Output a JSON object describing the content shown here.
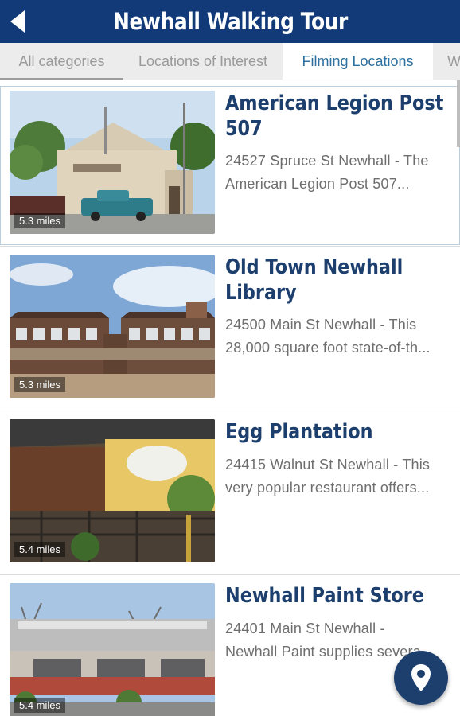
{
  "header": {
    "title": "Newhall Walking Tour"
  },
  "tabs": [
    {
      "label": "All categories"
    },
    {
      "label": "Locations of Interest"
    },
    {
      "label": "Filming Locations"
    },
    {
      "label": "W"
    }
  ],
  "items": [
    {
      "title_line1": "American Legion Post",
      "title_line2": "507",
      "desc_line1": "24527 Spruce St Newhall - The",
      "desc_line2": "American Legion Post 507...",
      "distance": "5.3 miles"
    },
    {
      "title_line1": "Old Town Newhall",
      "title_line2": "Library",
      "desc_line1": "24500 Main St Newhall - This",
      "desc_line2": "28,000 square foot state-of-th...",
      "distance": "5.3 miles"
    },
    {
      "title_line1": "Egg Plantation",
      "title_line2": "",
      "desc_line1": "24415 Walnut St Newhall - This",
      "desc_line2": "very popular restaurant offers...",
      "distance": "5.4 miles"
    },
    {
      "title_line1": "Newhall Paint Store",
      "title_line2": "",
      "desc_line1": "24401 Main St Newhall -",
      "desc_line2": "Newhall Paint supplies severa...",
      "distance": "5.4 miles"
    }
  ],
  "icons": {
    "back": "back-arrow-icon",
    "fab": "map-pin-icon"
  },
  "colors": {
    "header_bg": "#123a78",
    "title_text": "#1d3f6e",
    "active_tab_text": "#2d6f9e"
  }
}
